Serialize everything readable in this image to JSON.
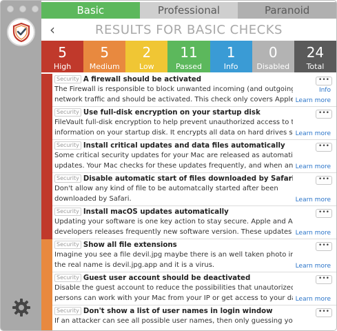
{
  "colors": {
    "high": "#c0392b",
    "medium": "#e8893f",
    "low": "#f0c634",
    "passed": "#5cb85c",
    "info": "#3a9bd5",
    "disabled": "#b3b3b3",
    "total": "#5a5a5a",
    "sidebar": "#a9a9a9"
  },
  "tabs": [
    "Basic",
    "Professional",
    "Paranoid"
  ],
  "header": {
    "back": "‹",
    "title": "RESULTS FOR BASIC CHECKS"
  },
  "stats": [
    {
      "value": "5",
      "label": "High",
      "color": "#c0392b"
    },
    {
      "value": "5",
      "label": "Medium",
      "color": "#e8893f"
    },
    {
      "value": "2",
      "label": "Low",
      "color": "#f0c634"
    },
    {
      "value": "11",
      "label": "Passed",
      "color": "#5cb85c"
    },
    {
      "value": "1",
      "label": "Info",
      "color": "#3a9bd5"
    },
    {
      "value": "0",
      "label": "Disabled",
      "color": "#b3b3b3"
    },
    {
      "value": "24",
      "label": "Total",
      "color": "#5a5a5a"
    }
  ],
  "items": [
    {
      "badge": "Security",
      "title": "A firewall should be activated",
      "line1": "The Firewall is responsible to block unwanted incoming (and outgoing)",
      "line2": "network traffic and should be activated. This check only covers Apple...",
      "severity": "high",
      "info": "Info",
      "learn": "Learn more",
      "more": "•••"
    },
    {
      "badge": "Security",
      "title": "Use full-disk encryption on your startup disk",
      "line1": "FileVault full-disk encryption to help prevent unauthorized access to the",
      "line2": "information on your startup disk. It encrypts all data on hard drives so...",
      "severity": "high",
      "learn": "Learn more",
      "more": "•••"
    },
    {
      "badge": "Security",
      "title": "Install critical updates and data files automatically",
      "line1": "Some critical security updates for your Mac are released as automatic",
      "line2": "updates. Your Mac checks for these updates frequently, and when an a...",
      "severity": "high",
      "learn": "Learn more",
      "more": "•••"
    },
    {
      "badge": "Security",
      "title": "Disable automatic start of files downloaded by Safari",
      "line1": "Don't allow any kind of file to be automatcally started after been",
      "line2": "downloaded by Safari.",
      "severity": "high",
      "learn": "Learn more",
      "more": "•••"
    },
    {
      "badge": "Security",
      "title": "Install macOS updates automatically",
      "line1": "Updating your software is one key action to stay secure. Apple and App",
      "line2": "developers releases frequently new software version. These updates m...",
      "severity": "high",
      "learn": "Learn more",
      "more": "•••"
    },
    {
      "badge": "Security",
      "title": "Show all file extensions",
      "line1": "Imagine you see a file devil.jpg maybe there is an well taken photo in, but",
      "line2": "the real name is devil.jpg.app and it is a virus.",
      "severity": "medium",
      "learn": "Learn more",
      "more": "•••"
    },
    {
      "badge": "Security",
      "title": "Guest user account should be deactivated",
      "line1": "Disable the guest account to reduce the possibilities that unautorized",
      "line2": "persons can work with your Mac from your IP or get access to your data.",
      "severity": "medium",
      "learn": "Learn more",
      "more": "•••"
    },
    {
      "badge": "Security",
      "title": "Don't show a list of user names in login window",
      "line1": "If an attacker can see all possible user names, then only guessing your",
      "line2": "",
      "severity": "medium",
      "learn": "",
      "more": "•••"
    }
  ]
}
